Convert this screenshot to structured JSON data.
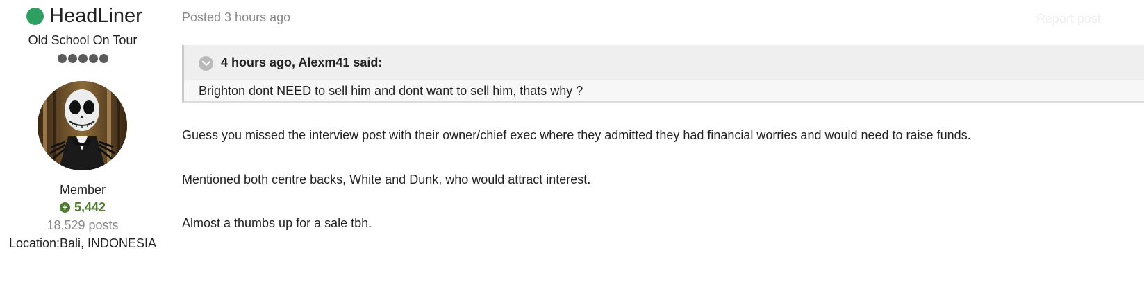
{
  "author": {
    "name": "HeadLiner",
    "online_status_color": "#2e9e63",
    "title": "Old School On Tour",
    "rank_pips": 5,
    "group": "Member",
    "reputation": "5,442",
    "reputation_color": "#4f7a30",
    "post_count": "18,529 posts",
    "location": "Location:Bali, INDONESIA"
  },
  "post": {
    "posted_time": "Posted 3 hours ago",
    "report_link": "Report post",
    "quote": {
      "citation": "4 hours ago, Alexm41 said:",
      "text": "Brighton dont NEED to sell him and dont want to sell him, thats why ?"
    },
    "paragraphs": [
      "Guess you missed the interview post with their owner/chief exec where they admitted they had financial worries and would need to raise funds.",
      "Mentioned both centre backs, White and Dunk, who would attract interest.",
      "Almost a thumbs up for a sale tbh."
    ]
  }
}
